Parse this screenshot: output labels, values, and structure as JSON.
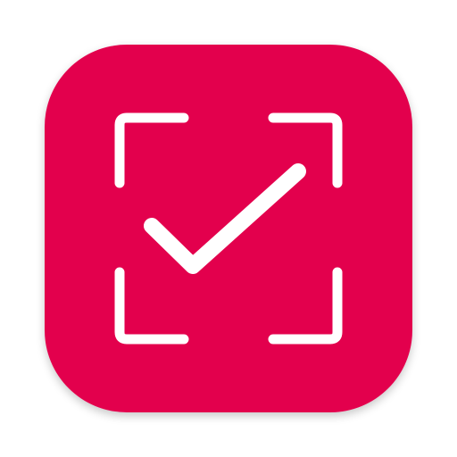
{
  "app_icon": {
    "name": "scan-check-app-icon",
    "glyph": "scan-frame-checkmark-icon",
    "colors": {
      "background": "#E3004D",
      "glyph": "#FFFFFF"
    }
  }
}
